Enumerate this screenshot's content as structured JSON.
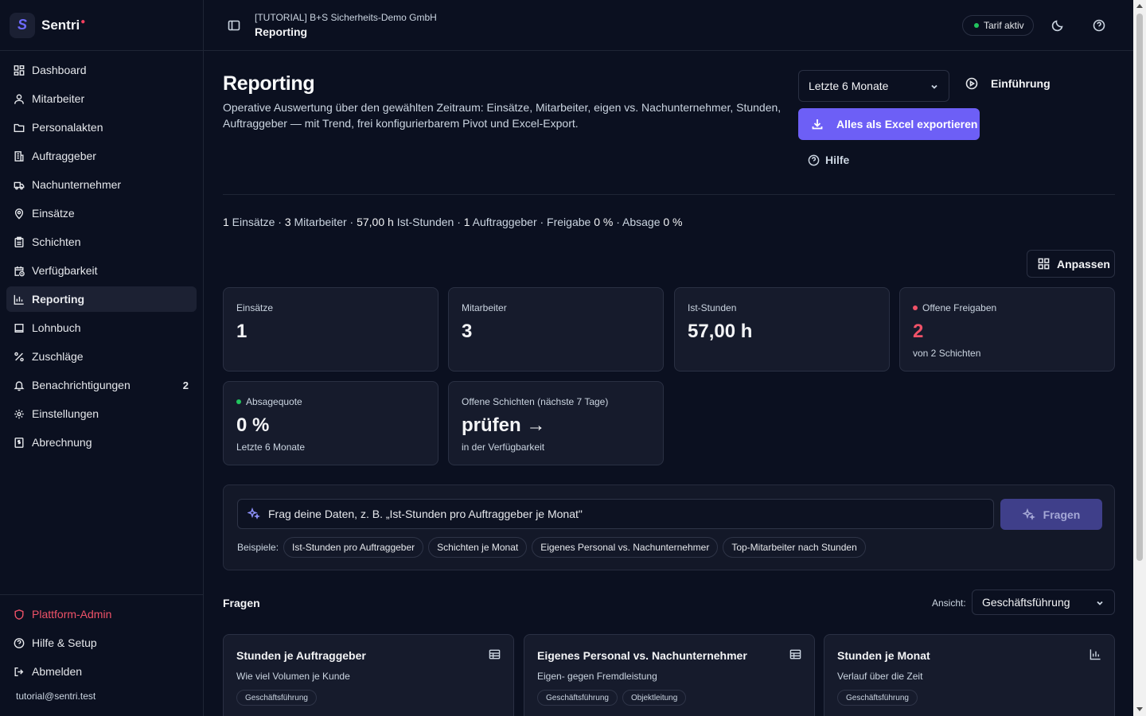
{
  "brand": {
    "name": "Sentri",
    "logo_letter": "S"
  },
  "sidebar": {
    "items": [
      {
        "label": "Dashboard",
        "icon": "dashboard-icon"
      },
      {
        "label": "Mitarbeiter",
        "icon": "user-icon"
      },
      {
        "label": "Personalakten",
        "icon": "folder-icon"
      },
      {
        "label": "Auftraggeber",
        "icon": "building-icon"
      },
      {
        "label": "Nachunternehmer",
        "icon": "truck-icon"
      },
      {
        "label": "Einsätze",
        "icon": "map-pin-icon"
      },
      {
        "label": "Schichten",
        "icon": "clipboard-icon"
      },
      {
        "label": "Verfügbarkeit",
        "icon": "calendar-clock-icon"
      },
      {
        "label": "Reporting",
        "icon": "bar-chart-icon",
        "active": true
      },
      {
        "label": "Lohnbuch",
        "icon": "book-icon"
      },
      {
        "label": "Zuschläge",
        "icon": "percent-icon"
      },
      {
        "label": "Benachrichtigungen",
        "icon": "bell-icon",
        "badge": "2"
      },
      {
        "label": "Einstellungen",
        "icon": "gear-icon"
      },
      {
        "label": "Abrechnung",
        "icon": "receipt-icon"
      }
    ],
    "bottom": {
      "admin": "Plattform-Admin",
      "help": "Hilfe & Setup",
      "logout": "Abmelden",
      "email": "tutorial@sentri.test"
    }
  },
  "topbar": {
    "org": "[TUTORIAL] B+S Sicherheits-Demo GmbH",
    "title": "Reporting",
    "tarif": "Tarif aktiv"
  },
  "header": {
    "title": "Reporting",
    "description": "Operative Auswertung über den gewählten Zeitraum: Einsätze, Mitarbeiter, eigen vs. Nachunternehmer, Stunden, Auftraggeber — mit Trend, frei konfigurierbarem Pivot und Excel-Export.",
    "period": "Letzte 6 Monate",
    "intro": "Einführung",
    "export": "Alles als Excel exportieren",
    "help": "Hilfe"
  },
  "summary": {
    "einsaetze_count": "1",
    "einsaetze_label": " Einsätze · ",
    "mitarbeiter_count": "3",
    "mitarbeiter_label": " Mitarbeiter · ",
    "stunden_value": "57,00 h",
    "stunden_label": " Ist-Stunden · ",
    "auftraggeber_count": "1",
    "auftraggeber_label": " Auftraggeber · Freigabe ",
    "freigabe_value": "0 %",
    "absage_label": " · Absage ",
    "absage_value": "0 %"
  },
  "customize": "Anpassen",
  "kpis": {
    "einsaetze": {
      "label": "Einsätze",
      "value": "1"
    },
    "mitarbeiter": {
      "label": "Mitarbeiter",
      "value": "3"
    },
    "stunden": {
      "label": "Ist-Stunden",
      "value": "57,00 h"
    },
    "freigaben": {
      "label": "Offene Freigaben",
      "value": "2",
      "sub": "von 2 Schichten",
      "status_color": "#f05268"
    },
    "absagequote": {
      "label": "Absagequote",
      "value": "0 %",
      "sub": "Letzte 6 Monate",
      "status_color": "#22c55e"
    },
    "offene_schichten": {
      "label": "Offene Schichten (nächste 7 Tage)",
      "value": "prüfen →",
      "sub": "in der Verfügbarkeit"
    }
  },
  "ask": {
    "placeholder": "Frag deine Daten, z. B. „Ist-Stunden pro Auftraggeber je Monat\"",
    "button": "Fragen",
    "examples_label": "Beispiele:",
    "examples": [
      "Ist-Stunden pro Auftraggeber",
      "Schichten je Monat",
      "Eigenes Personal vs. Nachunternehmer",
      "Top-Mitarbeiter nach Stunden"
    ]
  },
  "questions": {
    "title": "Fragen",
    "view_label": "Ansicht:",
    "view_value": "Geschäftsführung",
    "cards": [
      {
        "title": "Stunden je Auftraggeber",
        "desc": "Wie viel Volumen je Kunde",
        "tags": [
          "Geschäftsführung"
        ],
        "icon": "table-icon"
      },
      {
        "title": "Eigenes Personal vs. Nachunternehmer",
        "desc": "Eigen- gegen Fremdleistung",
        "tags": [
          "Geschäftsführung",
          "Objektleitung"
        ],
        "icon": "table-icon"
      },
      {
        "title": "Stunden je Monat",
        "desc": "Verlauf über die Zeit",
        "tags": [
          "Geschäftsführung"
        ],
        "icon": "bar-chart-icon"
      }
    ]
  },
  "colors": {
    "accent": "#6d5ff6",
    "danger": "#f05268",
    "success": "#22c55e",
    "background": "#0b1020"
  }
}
